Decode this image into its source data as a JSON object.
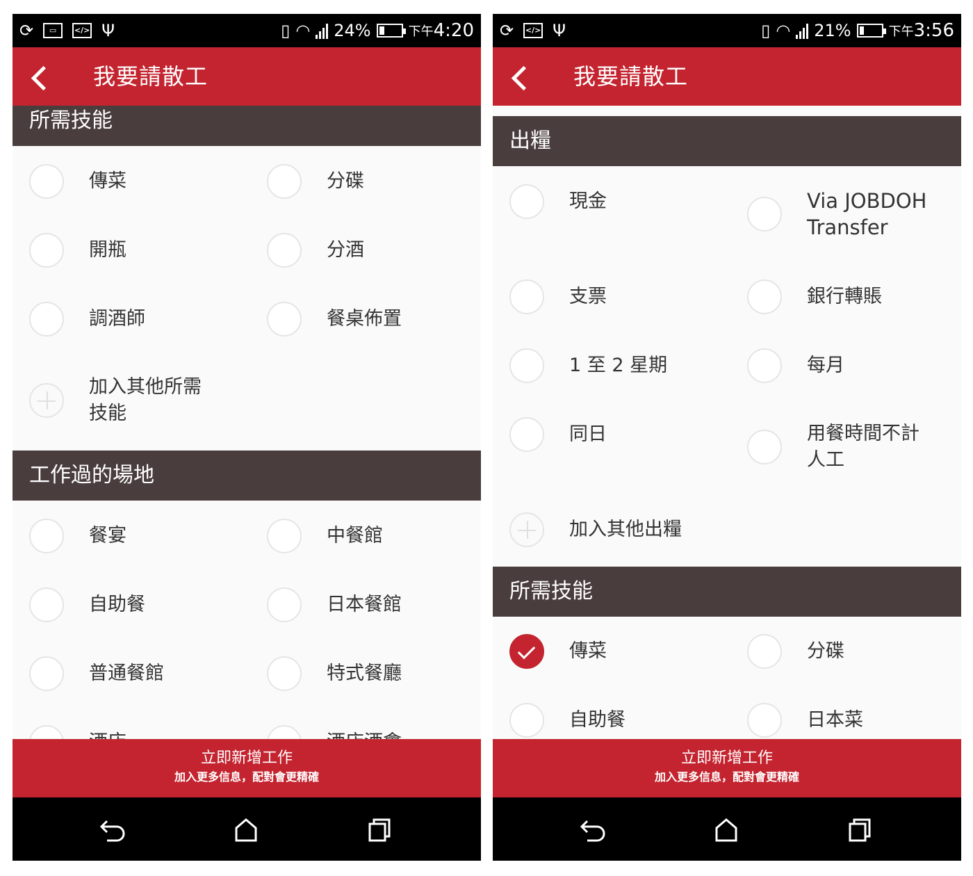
{
  "screens": [
    {
      "status": {
        "battery": "24%",
        "time_prefix": "下午",
        "time": "4:20",
        "left_icons": [
          "sync-icon",
          "image-icon",
          "code-icon",
          "usb-icon"
        ]
      },
      "app_title": "我要請散工",
      "sections": [
        {
          "title": "所需技能",
          "options": [
            {
              "label": "傳菜",
              "checked": false
            },
            {
              "label": "分碟",
              "checked": false
            },
            {
              "label": "開瓶",
              "checked": false
            },
            {
              "label": "分酒",
              "checked": false
            },
            {
              "label": "調酒師",
              "checked": false
            },
            {
              "label": "餐桌佈置",
              "checked": false
            }
          ],
          "add_label_line1": "加入其他所需",
          "add_label_line2": "技能"
        },
        {
          "title": "工作過的場地",
          "options": [
            {
              "label": "餐宴",
              "checked": false
            },
            {
              "label": "中餐館",
              "checked": false
            },
            {
              "label": "自助餐",
              "checked": false
            },
            {
              "label": "日本餐館",
              "checked": false
            },
            {
              "label": "普通餐館",
              "checked": false
            },
            {
              "label": "特式餐廳",
              "checked": false
            },
            {
              "label": "酒店",
              "checked": false
            },
            {
              "label": "酒店酒會",
              "checked": false
            }
          ]
        }
      ],
      "cta": {
        "title": "立即新增工作",
        "subtitle": "加入更多信息，配對會更精確"
      }
    },
    {
      "status": {
        "battery": "21%",
        "time_prefix": "下午",
        "time": "3:56",
        "left_icons": [
          "sync-icon",
          "code-icon",
          "usb-icon"
        ]
      },
      "app_title": "我要請散工",
      "sections": [
        {
          "title": "出糧",
          "options": [
            {
              "label": "現金",
              "checked": false
            },
            {
              "label": "Via JOBDOH Transfer",
              "line1": "Via JOBDOH",
              "line2": "Transfer",
              "checked": false
            },
            {
              "label": "支票",
              "checked": false
            },
            {
              "label": "銀行轉賬",
              "checked": false
            },
            {
              "label": "1 至 2 星期",
              "checked": false
            },
            {
              "label": "每月",
              "checked": false
            },
            {
              "label": "同日",
              "checked": false
            },
            {
              "label": "用餐時間不計人工",
              "line1": "用餐時間不計",
              "line2": "人工",
              "checked": false
            }
          ],
          "add_label": "加入其他出糧"
        },
        {
          "title": "所需技能",
          "options": [
            {
              "label": "傳菜",
              "checked": true
            },
            {
              "label": "分碟",
              "checked": false
            },
            {
              "label": "自助餐",
              "checked": false
            },
            {
              "label": "日本菜",
              "checked": false
            }
          ]
        }
      ],
      "cta": {
        "title": "立即新增工作",
        "subtitle": "加入更多信息，配對會更精確"
      }
    }
  ],
  "colors": {
    "accent": "#c4242f",
    "section_bg": "#4a3d3d",
    "background": "#fafafa"
  }
}
